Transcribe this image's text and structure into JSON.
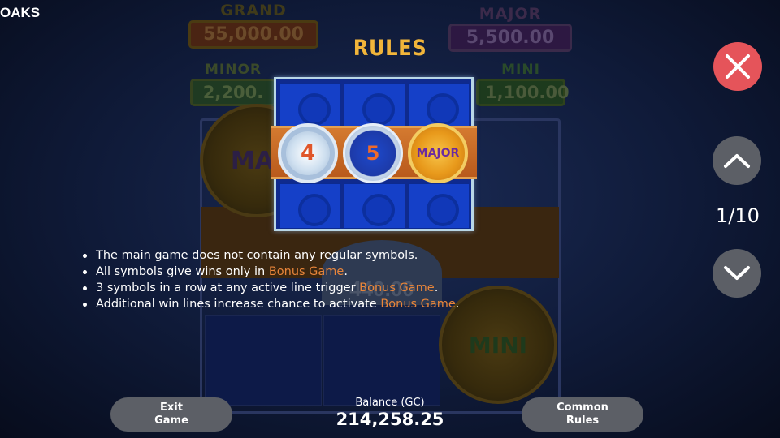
{
  "header": {
    "brand": "OAKS"
  },
  "background_jackpots": {
    "grand": {
      "name": "GRAND",
      "value": "55,000.00"
    },
    "major": {
      "name": "MAJOR",
      "value": "5,500.00"
    },
    "minor": {
      "name": "MINOR",
      "value": "2,200."
    },
    "mini": {
      "name": "MINI",
      "value": "1,100.00"
    },
    "coin_major_text": "MAJ",
    "coin_mini_text": "MINI",
    "coin_silver_text": "440.00"
  },
  "rules": {
    "title": "RULES",
    "illustration": {
      "coins": [
        {
          "label": "4",
          "kind": "silver"
        },
        {
          "label": "5",
          "kind": "blue"
        },
        {
          "label": "MAJOR",
          "kind": "gold"
        }
      ]
    },
    "items": [
      {
        "text": "The main game does not contain any regular symbols.",
        "highlight": "",
        "suffix": ""
      },
      {
        "text": "All symbols give wins only in ",
        "highlight": "Bonus Game",
        "suffix": "."
      },
      {
        "text": "3 symbols in a row at any active line trigger ",
        "highlight": "Bonus Game",
        "suffix": "."
      },
      {
        "text": "Additional win lines increase chance to activate ",
        "highlight": "Bonus Game",
        "suffix": "."
      }
    ]
  },
  "controls": {
    "close_icon": "close-icon",
    "up_icon": "chevron-up-icon",
    "down_icon": "chevron-down-icon",
    "page_indicator": "1/10"
  },
  "footer": {
    "exit_line1": "Exit",
    "exit_line2": "Game",
    "balance_label": "Balance (GC)",
    "balance_value": "214,258.25",
    "common_line1": "Common",
    "common_line2": "Rules"
  },
  "colors": {
    "accent": "#f2b53a",
    "highlight": "#e8853a",
    "close_button": "#e5545a",
    "control_button": "#5c5f66"
  }
}
